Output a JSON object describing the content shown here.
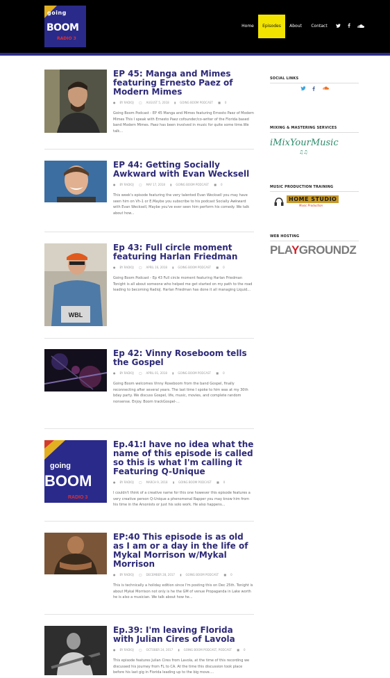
{
  "header": {
    "logo": {
      "line1": "going",
      "line2": "BOOM",
      "line3": "RADIO 3"
    },
    "nav": [
      {
        "label": "Home",
        "active": false
      },
      {
        "label": "Episodes",
        "active": true
      },
      {
        "label": "About",
        "active": false
      },
      {
        "label": "Contact",
        "active": false
      }
    ],
    "social_icons": [
      "twitter-icon",
      "facebook-icon",
      "soundcloud-icon"
    ],
    "accent": "#f2e400",
    "underline": "#2e2d8c"
  },
  "posts": [
    {
      "title": "EP 45: Manga and Mimes featuring Ernesto Paez of Modern Mimes",
      "author": "BY RADIOJ",
      "date": "AUGUST 5, 2018",
      "category": "GOING BOOM PODCAST",
      "comments": "0",
      "excerpt": "Going Boom Podcast - EP 45 Manga and Mimes featuring Ernesto Paez of Modern Mimes This I speak with Ernesto Paez cofounder/co-writer of the Florida based band Modern Mimes. Paez has been involved in music for quite some time.We talk..."
    },
    {
      "title": "EP 44: Getting Socially Awkward with Evan Wecksell",
      "author": "BY RADIOJ",
      "date": "MAY 17, 2018",
      "category": "GOING BOOM PODCAST",
      "comments": "0",
      "excerpt": "This week's episode featuring the very talented Evan Wecksell you may have seen him on Vh-1 or E.Maybe you subscribe to his podcast Socially Awkward with Evan Wecksell, Maybe you've ever seen him perform his comedy. We talk about how..."
    },
    {
      "title": "Ep 43: Full circle moment featuring Harlan Friedman",
      "author": "BY RADIOJ",
      "date": "APRIL 16, 2018",
      "category": "GOING BOOM PODCAST",
      "comments": "0",
      "excerpt": "Going Boom Podcast - Ep 43 Full circle moment featuring Harlan Friedman Tonight is all about someone who helped me get started on my path to the road leading to becoming RadioJ. Harlan Friedman has done it all managing Liquid..."
    },
    {
      "title": "Ep 42: Vinny Roseboom tells the Gospel",
      "author": "BY RADIOJ",
      "date": "APRIL 01, 2018",
      "category": "GOING BOOM PODCAST",
      "comments": "0",
      "excerpt": "Going Boom welcomes Vinny Roseboom from the band Gospel, finally reconnecting after several years. The last time I spoke to him was at my 30th bday party. We discuss Gospel, life, music, movies, and complete random nonsense. Enjoy. Boom trackGospel-..."
    },
    {
      "title": "Ep.41:I have no idea what the name of this episode is called so this is what I'm calling it Featuring Q-Unique",
      "author": "BY RADIOJ",
      "date": "MARCH 9, 2018",
      "category": "GOING BOOM PODCAST",
      "comments": "0",
      "excerpt": "I couldn't think of a creative name for this one however this episode features a very creative person Q-Unique a phenomenal Rapper you may know him from his time in the Arsonists or just his solo work. He also happens..."
    },
    {
      "title": "EP:40 This episode is as old as I am or a day in the life of Mykal Morrison w/Mykal Morrison",
      "author": "BY RADIOJ",
      "date": "DECEMBER 28, 2017",
      "category": "GOING BOOM PODCAST",
      "comments": "0",
      "excerpt": "This is technically a holiday edition since I'm posting this on Dec 25th. Tonight is about Mykal Morrison not only is he the GM of venue Propaganda in Lake worth he is also a musician. We talk about how he..."
    },
    {
      "title": "Ep.39: I'm leaving Florida with Julian Cires of Lavola",
      "author": "BY RADIOJ",
      "date": "OCTOBER 24, 2017",
      "category": "GOING BOOM PODCAST, PODCAST",
      "comments": "0",
      "excerpt": "This episode features Julian Cires from Lavola, at the time of this recording we discussed his journey from FL to CA. At the time this discussion took place before his last gig in Florida leading up to the big move...."
    }
  ],
  "sidebar": {
    "social": {
      "title": "SOCIAL LINKS",
      "icons": [
        "twitter-icon",
        "facebook-icon",
        "soundcloud-icon"
      ]
    },
    "mixing": {
      "title": "MIXING & MASTERING SERVICES",
      "brand": "iMixYourMusic"
    },
    "training": {
      "title": "MUSIC PRODUCTION TRAINING",
      "brand": "HOME STUDIO",
      "sub": "Music Production"
    },
    "hosting": {
      "title": "WEB HOSTING",
      "brand_a": "PLA",
      "brand_b": "Y",
      "brand_c": "GROUNDZ"
    }
  }
}
